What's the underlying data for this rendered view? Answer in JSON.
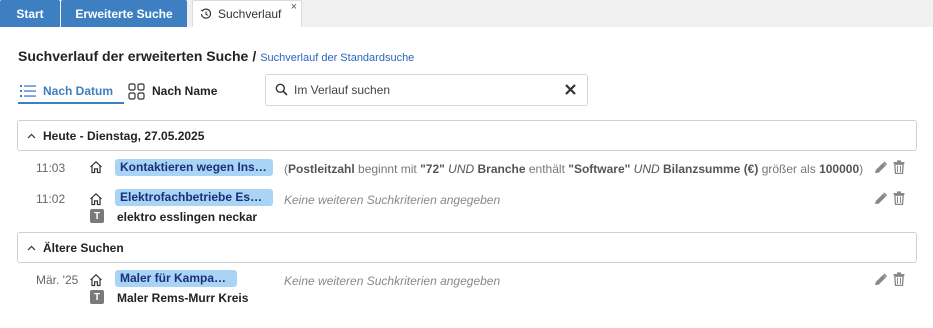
{
  "tabs": [
    {
      "label": "Start"
    },
    {
      "label": "Erweiterte Suche"
    },
    {
      "label": "Suchverlauf",
      "close": "×"
    }
  ],
  "heading": {
    "main": "Suchverlauf der erweiterten Suche",
    "separator": "/",
    "link": "Suchverlauf der Standardsuche"
  },
  "sort": {
    "by_date": "Nach Datum",
    "by_name": "Nach Name"
  },
  "search": {
    "placeholder": "Im Verlauf suchen",
    "value": ""
  },
  "groups": [
    {
      "label": "Heute - Dienstag, 27.05.2025",
      "entries": [
        {
          "time": "11:03",
          "name": "Kontaktieren wegen Ins…",
          "criteria": {
            "open": "(",
            "f1": "Postleitzahl",
            "op1": "beginnt mit",
            "v1": "\"72\"",
            "and1": "UND",
            "f2": "Branche",
            "op2": "enthält",
            "v2": "\"Software\"",
            "and2": "UND",
            "f3": "Bilanzsumme (€)",
            "op3": "größer als",
            "v3": "100000",
            "close": ")"
          }
        },
        {
          "time": "11:02",
          "name": "Elektrofachbetriebe Essl…",
          "none_text": "Keine weiteren Suchkriterien angegeben",
          "badge": "T",
          "text_term": "elektro esslingen neckar"
        }
      ]
    },
    {
      "label": "Ältere Suchen",
      "entries": [
        {
          "time": "Mär. '25",
          "name": "Maler für Kampagne",
          "none_text": "Keine weiteren Suchkriterien angegeben",
          "badge": "T",
          "text_term": "Maler Rems-Murr Kreis"
        }
      ]
    }
  ],
  "colors": {
    "primary": "#3d7fc1",
    "pill_bg": "#a9d4f5",
    "pill_text": "#1a2f7a"
  },
  "icons": {
    "history": "history-icon",
    "list": "list-icon",
    "grid": "grid-icon",
    "search": "search-icon",
    "clear": "close-icon",
    "chevron": "chevron-up-icon",
    "home": "home-icon",
    "edit": "edit-icon",
    "delete": "trash-icon"
  }
}
